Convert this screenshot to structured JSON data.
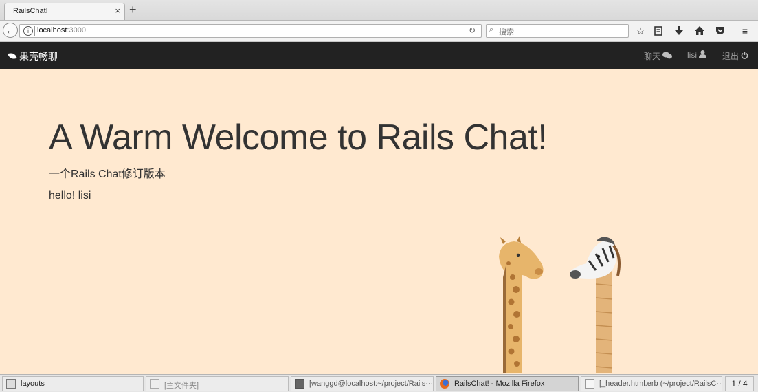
{
  "browser": {
    "tab_title": "RailsChat!",
    "tab_close": "×",
    "new_tab": "+",
    "url_host": "localhost",
    "url_port": ":3000",
    "search_placeholder": "搜索"
  },
  "site": {
    "brand": "果壳畅聊",
    "nav": {
      "chat": "聊天",
      "user": "lisi",
      "logout": "退出"
    }
  },
  "main": {
    "title": "A Warm Welcome to Rails Chat!",
    "subtitle": "一个Rails Chat修订版本",
    "greeting_prefix": "hello!",
    "greeting_name": "lisi"
  },
  "taskbar": {
    "items": [
      {
        "label": "layouts"
      },
      {
        "label": "[主文件夹]"
      },
      {
        "label": "[wanggd@localhost:~/project/Rails···"
      },
      {
        "label": "RailsChat! - Mozilla Firefox"
      },
      {
        "label": "[_header.html.erb (~/project/RailsC···"
      }
    ],
    "workspace": "1 / 4"
  },
  "colors": {
    "page_bg": "#ffe9d0",
    "header_bg": "#222222",
    "text": "#333333"
  }
}
